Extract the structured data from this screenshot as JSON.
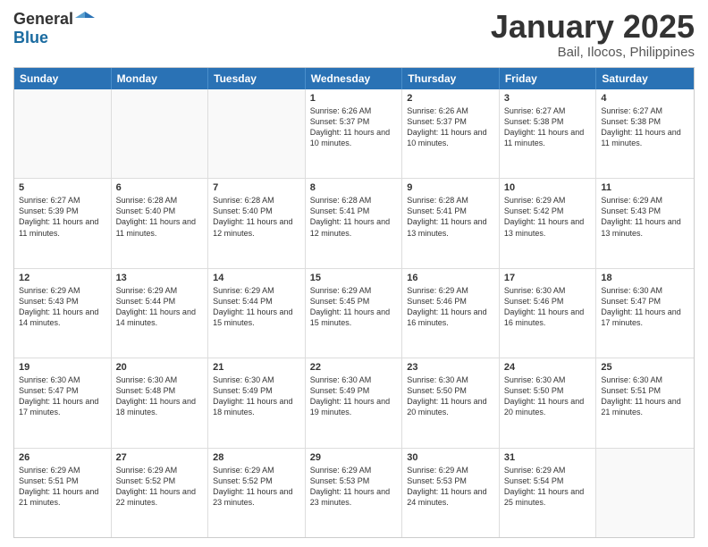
{
  "logo": {
    "general": "General",
    "blue": "Blue"
  },
  "title": "January 2025",
  "location": "Bail, Ilocos, Philippines",
  "days": [
    "Sunday",
    "Monday",
    "Tuesday",
    "Wednesday",
    "Thursday",
    "Friday",
    "Saturday"
  ],
  "weeks": [
    [
      {
        "day": "",
        "empty": true
      },
      {
        "day": "",
        "empty": true
      },
      {
        "day": "",
        "empty": true
      },
      {
        "day": "1",
        "sunrise": "6:26 AM",
        "sunset": "5:37 PM",
        "daylight": "11 hours and 10 minutes."
      },
      {
        "day": "2",
        "sunrise": "6:26 AM",
        "sunset": "5:37 PM",
        "daylight": "11 hours and 10 minutes."
      },
      {
        "day": "3",
        "sunrise": "6:27 AM",
        "sunset": "5:38 PM",
        "daylight": "11 hours and 11 minutes."
      },
      {
        "day": "4",
        "sunrise": "6:27 AM",
        "sunset": "5:38 PM",
        "daylight": "11 hours and 11 minutes."
      }
    ],
    [
      {
        "day": "5",
        "sunrise": "6:27 AM",
        "sunset": "5:39 PM",
        "daylight": "11 hours and 11 minutes."
      },
      {
        "day": "6",
        "sunrise": "6:28 AM",
        "sunset": "5:40 PM",
        "daylight": "11 hours and 11 minutes."
      },
      {
        "day": "7",
        "sunrise": "6:28 AM",
        "sunset": "5:40 PM",
        "daylight": "11 hours and 12 minutes."
      },
      {
        "day": "8",
        "sunrise": "6:28 AM",
        "sunset": "5:41 PM",
        "daylight": "11 hours and 12 minutes."
      },
      {
        "day": "9",
        "sunrise": "6:28 AM",
        "sunset": "5:41 PM",
        "daylight": "11 hours and 13 minutes."
      },
      {
        "day": "10",
        "sunrise": "6:29 AM",
        "sunset": "5:42 PM",
        "daylight": "11 hours and 13 minutes."
      },
      {
        "day": "11",
        "sunrise": "6:29 AM",
        "sunset": "5:43 PM",
        "daylight": "11 hours and 13 minutes."
      }
    ],
    [
      {
        "day": "12",
        "sunrise": "6:29 AM",
        "sunset": "5:43 PM",
        "daylight": "11 hours and 14 minutes."
      },
      {
        "day": "13",
        "sunrise": "6:29 AM",
        "sunset": "5:44 PM",
        "daylight": "11 hours and 14 minutes."
      },
      {
        "day": "14",
        "sunrise": "6:29 AM",
        "sunset": "5:44 PM",
        "daylight": "11 hours and 15 minutes."
      },
      {
        "day": "15",
        "sunrise": "6:29 AM",
        "sunset": "5:45 PM",
        "daylight": "11 hours and 15 minutes."
      },
      {
        "day": "16",
        "sunrise": "6:29 AM",
        "sunset": "5:46 PM",
        "daylight": "11 hours and 16 minutes."
      },
      {
        "day": "17",
        "sunrise": "6:30 AM",
        "sunset": "5:46 PM",
        "daylight": "11 hours and 16 minutes."
      },
      {
        "day": "18",
        "sunrise": "6:30 AM",
        "sunset": "5:47 PM",
        "daylight": "11 hours and 17 minutes."
      }
    ],
    [
      {
        "day": "19",
        "sunrise": "6:30 AM",
        "sunset": "5:47 PM",
        "daylight": "11 hours and 17 minutes."
      },
      {
        "day": "20",
        "sunrise": "6:30 AM",
        "sunset": "5:48 PM",
        "daylight": "11 hours and 18 minutes."
      },
      {
        "day": "21",
        "sunrise": "6:30 AM",
        "sunset": "5:49 PM",
        "daylight": "11 hours and 18 minutes."
      },
      {
        "day": "22",
        "sunrise": "6:30 AM",
        "sunset": "5:49 PM",
        "daylight": "11 hours and 19 minutes."
      },
      {
        "day": "23",
        "sunrise": "6:30 AM",
        "sunset": "5:50 PM",
        "daylight": "11 hours and 20 minutes."
      },
      {
        "day": "24",
        "sunrise": "6:30 AM",
        "sunset": "5:50 PM",
        "daylight": "11 hours and 20 minutes."
      },
      {
        "day": "25",
        "sunrise": "6:30 AM",
        "sunset": "5:51 PM",
        "daylight": "11 hours and 21 minutes."
      }
    ],
    [
      {
        "day": "26",
        "sunrise": "6:29 AM",
        "sunset": "5:51 PM",
        "daylight": "11 hours and 21 minutes."
      },
      {
        "day": "27",
        "sunrise": "6:29 AM",
        "sunset": "5:52 PM",
        "daylight": "11 hours and 22 minutes."
      },
      {
        "day": "28",
        "sunrise": "6:29 AM",
        "sunset": "5:52 PM",
        "daylight": "11 hours and 23 minutes."
      },
      {
        "day": "29",
        "sunrise": "6:29 AM",
        "sunset": "5:53 PM",
        "daylight": "11 hours and 23 minutes."
      },
      {
        "day": "30",
        "sunrise": "6:29 AM",
        "sunset": "5:53 PM",
        "daylight": "11 hours and 24 minutes."
      },
      {
        "day": "31",
        "sunrise": "6:29 AM",
        "sunset": "5:54 PM",
        "daylight": "11 hours and 25 minutes."
      },
      {
        "day": "",
        "empty": true
      }
    ]
  ],
  "labels": {
    "sunrise": "Sunrise:",
    "sunset": "Sunset:",
    "daylight": "Daylight:"
  }
}
